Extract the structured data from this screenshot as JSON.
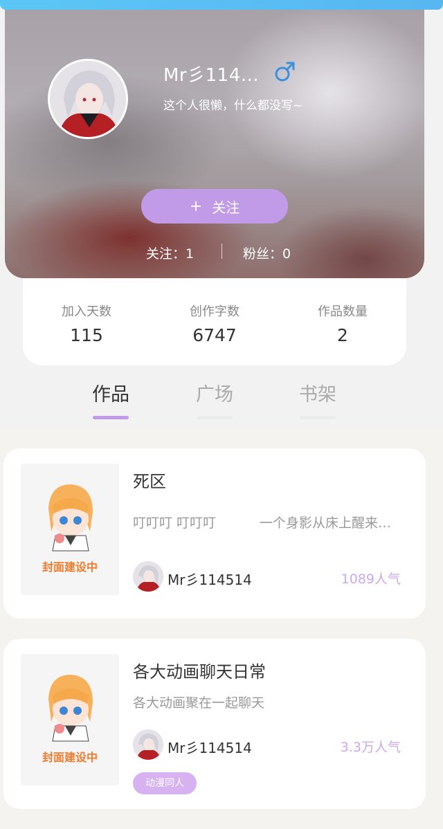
{
  "profile": {
    "username": "Mr彡114…",
    "gender_icon": "male-icon",
    "bio": "这个人很懒，什么都没写~",
    "follow_label": "关注",
    "following_text": "关注：1",
    "fans_text": "粉丝：0"
  },
  "stats": [
    {
      "label": "加入天数",
      "value": "115"
    },
    {
      "label": "创作字数",
      "value": "6747"
    },
    {
      "label": "作品数量",
      "value": "2"
    }
  ],
  "tabs": [
    {
      "label": "作品",
      "active": true
    },
    {
      "label": "广场",
      "active": false
    },
    {
      "label": "书架",
      "active": false
    }
  ],
  "works": [
    {
      "cover_text": "封面建设中",
      "title": "死区",
      "desc_tag": "叮叮叮 叮叮叮",
      "desc": "一个身影从床上醒来…",
      "author": "Mr彡114514",
      "popularity": "1089人气"
    },
    {
      "cover_text": "封面建设中",
      "title": "各大动画聊天日常",
      "desc": "各大动画聚在一起聊天",
      "author": "Mr彡114514",
      "popularity": "3.3万人气",
      "tag": "动漫同人"
    }
  ],
  "colors": {
    "accent": "#c29be8",
    "popularity": "#d0a8ea",
    "cover_text": "#ef7b2c",
    "male_icon": "#3a8fe0"
  }
}
